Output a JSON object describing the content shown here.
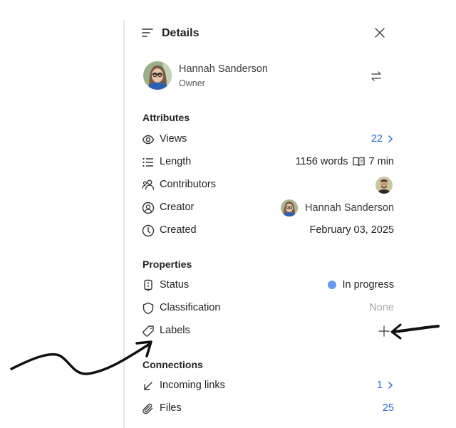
{
  "header": {
    "title": "Details",
    "menu_icon": "text-align-left-icon",
    "close_icon": "close-icon"
  },
  "owner": {
    "name": "Hannah Sanderson",
    "role": "Owner",
    "swap_icon": "swap-arrows-icon"
  },
  "attributes": {
    "title": "Attributes",
    "views": {
      "label": "Views",
      "value": "22",
      "icon": "eye-icon"
    },
    "length": {
      "label": "Length",
      "words": "1156 words",
      "read_time": "7 min",
      "icon": "list-icon",
      "read_icon": "book-icon"
    },
    "contributors": {
      "label": "Contributors",
      "icon": "people-icon"
    },
    "creator": {
      "label": "Creator",
      "value": "Hannah Sanderson",
      "icon": "person-circle-icon"
    },
    "created": {
      "label": "Created",
      "value": "February 03, 2025",
      "icon": "clock-icon"
    }
  },
  "properties": {
    "title": "Properties",
    "status": {
      "label": "Status",
      "value": "In progress",
      "dot_color": "#6b9bef",
      "icon": "status-icon"
    },
    "classification": {
      "label": "Classification",
      "value": "None",
      "icon": "shield-icon"
    },
    "labels": {
      "label": "Labels",
      "icon": "tag-icon",
      "add_icon": "plus-icon"
    }
  },
  "connections": {
    "title": "Connections",
    "incoming": {
      "label": "Incoming links",
      "value": "1",
      "icon": "arrow-down-left-icon"
    },
    "files": {
      "label": "Files",
      "value": "25",
      "icon": "paperclip-icon"
    }
  },
  "colors": {
    "accent": "#2a6ad6",
    "muted": "#a8a8a8",
    "border": "#e6e6e6"
  }
}
